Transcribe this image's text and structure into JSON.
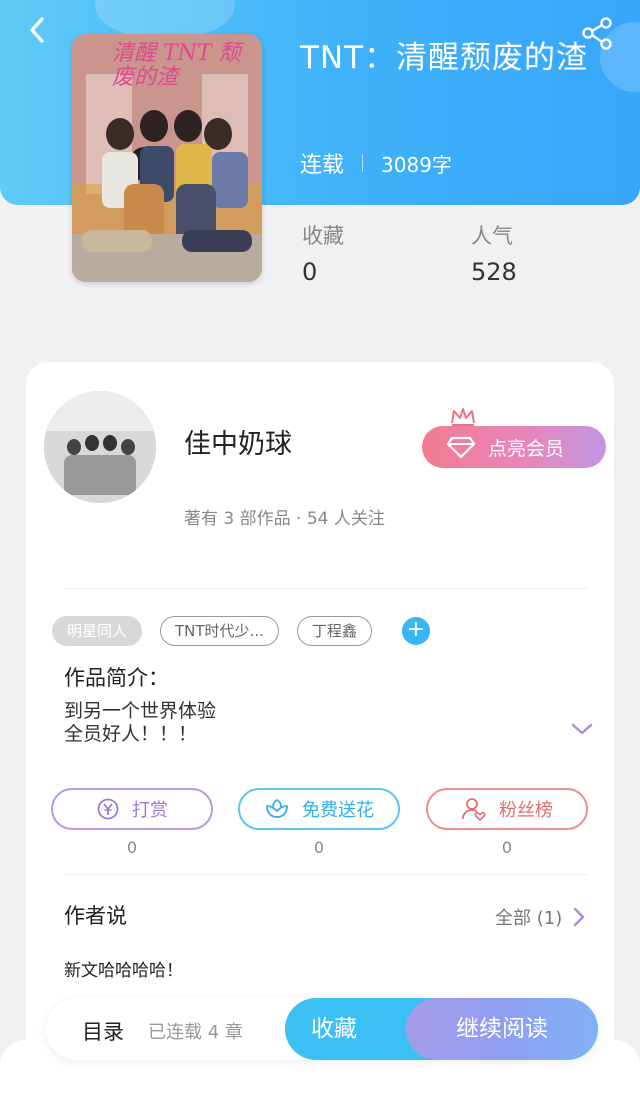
{
  "header": {
    "back_icon": "chevron-left-icon",
    "share_icon": "share-icon",
    "cover_text": "清醒 TNT 颓废的渣",
    "title": "TNT：清醒颓废的渣",
    "status": "连载",
    "word_count": "3089字"
  },
  "stats": {
    "favorites_label": "收藏",
    "favorites_value": "0",
    "popularity_label": "人气",
    "popularity_value": "528"
  },
  "author": {
    "name": "佳中奶球",
    "meta": "著有 3 部作品 · 54 人关注",
    "vip_button": "点亮会员"
  },
  "tags": [
    "明星同人",
    "TNT时代少...",
    "丁程鑫"
  ],
  "intro": {
    "title": "作品简介：",
    "line1": "到另一个世界体验",
    "line2": "全员好人！！！"
  },
  "actions": {
    "reward_label": "打赏",
    "reward_count": "0",
    "flower_label": "免费送花",
    "flower_count": "0",
    "fans_label": "粉丝榜",
    "fans_count": "0"
  },
  "author_say": {
    "title": "作者说",
    "all_link": "全部 (1)",
    "content": "新文哈哈哈哈！"
  },
  "bottom_bar": {
    "toc_label": "目录",
    "chapter_count": "已连载 4 章",
    "favorite_button": "收藏",
    "read_button": "继续阅读"
  },
  "colors": {
    "header_blue": "#3fb1f9",
    "accent_blue": "#38b6f5",
    "vip_pink": "#f37b8f",
    "vip_purple": "#c195e5"
  }
}
